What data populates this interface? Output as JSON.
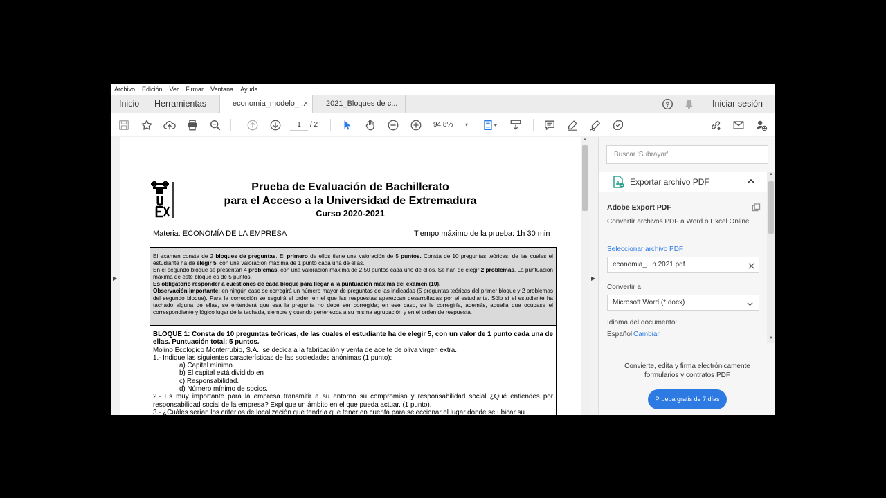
{
  "menu": [
    "Archivo",
    "Edición",
    "Ver",
    "Firmar",
    "Ventana",
    "Ayuda"
  ],
  "tabs": {
    "home": "Inicio",
    "tools": "Herramientas",
    "doc1": "economia_modelo_...",
    "doc2": "2021_Bloques de c...",
    "close": "×",
    "signin": "Iniciar sesión"
  },
  "toolbar": {
    "page_current": "1",
    "page_total": "/ 2",
    "zoom": "94,8%"
  },
  "document": {
    "title_line1": "Prueba de Evaluación de Bachillerato",
    "title_line2": "para el Acceso a la Universidad de Extremadura",
    "course": "Curso 2020-2021",
    "logo_text": "UEX",
    "subject": "Materia: ECONOMÍA DE LA EMPRESA",
    "time": "Tiempo máximo de la prueba: 1h 30 min",
    "notice": {
      "p1a": "El examen consta de 2 ",
      "p1b": "bloques de preguntas",
      "p1c": ". El ",
      "p1d": "primero",
      "p1e": " de ellos tiene una valoración de 5 ",
      "p1f": "puntos.",
      "p1g": " Consta de 10 preguntas teóricas, de las cuales el estudiante ha de ",
      "p1h": "elegir 5",
      "p1i": ", con una valoración máxima de 1 punto cada una de ellas.",
      "p2a": "En el segundo bloque se presentan 4 ",
      "p2b": "problemas",
      "p2c": ", con una valoración máxima de 2,50 puntos cada uno de ellos. Se han de elegir ",
      "p2d": "2 problemas",
      "p2e": ". La puntuación máxima de este bloque es de 5 puntos.",
      "p3": "Es obligatorio responder a cuestiones de cada bloque para llegar a la puntuación máxima del examen (10).",
      "p4a": "Observación importante:",
      "p4b": " en ningún caso se corregirá un número mayor de preguntas de las indicadas (5 preguntas teóricas del primer bloque y 2 problemas del segundo bloque). Para la corrección se seguirá el orden en el que las respuestas aparezcan desarrolladas por el estudiante. Sólo si el estudiante ha tachado alguna de ellas, se entenderá que esa la pregunta no debe ser corregida; en ese caso, se le corregiría, además, aquella que ocupase el correspondiente y lógico lugar de la tachada, siempre y cuando pertenezca a su misma agrupación y en el orden de respuesta."
    },
    "bloque": {
      "heading": "BLOQUE 1: Consta de 10 preguntas teóricas, de las cuales el estudiante ha de elegir 5, con un valor de 1 punto cada una de ellas. Puntuación total: 5 puntos.",
      "intro": "Molino Ecológico Monterrubio, S.A., se dedica a la fabricación y venta de aceite de oliva virgen extra.",
      "q1": "1.- Indique las siguientes características de las sociedades anónimas (1 punto):",
      "q1a": "a) Capital mínimo.",
      "q1b": "b) El capital está dividido en",
      "q1c": "c) Responsabilidad.",
      "q1d": "d) Número mínimo de socios.",
      "q2": "2.- Es muy importante para la empresa transmitir a su entorno su compromiso y responsabilidad social ¿Qué entiendes por responsabilidad social de la empresa? Explique un ámbito en el que pueda actuar. (1 punto).",
      "q3": "3.- ¿Cuáles serían los criterios de localización que tendría que tener en cuenta para seleccionar el lugar donde se ubicar su"
    }
  },
  "panel": {
    "search_placeholder": "Buscar 'Subrayar'",
    "export_header": "Exportar archivo PDF",
    "adobe_title": "Adobe Export PDF",
    "adobe_desc": "Convertir archivos PDF a Word o Excel Online",
    "select_label": "Seleccionar archivo PDF",
    "file_value": "economia_...n 2021.pdf",
    "convert_label": "Convertir a",
    "convert_value": "Microsoft Word (*.docx)",
    "lang_label": "Idioma del documento:",
    "lang_value": "Español",
    "lang_change": "Cambiar",
    "promo_line1": "Convierte, edita y firma electrónicamente",
    "promo_line2": "formularios y contratos PDF",
    "trial_button": "Prueba gratis de 7 días"
  },
  "colors": {
    "accent": "#2d7be2",
    "icon_gray": "#555555",
    "icon_blue": "#2d7be2"
  }
}
